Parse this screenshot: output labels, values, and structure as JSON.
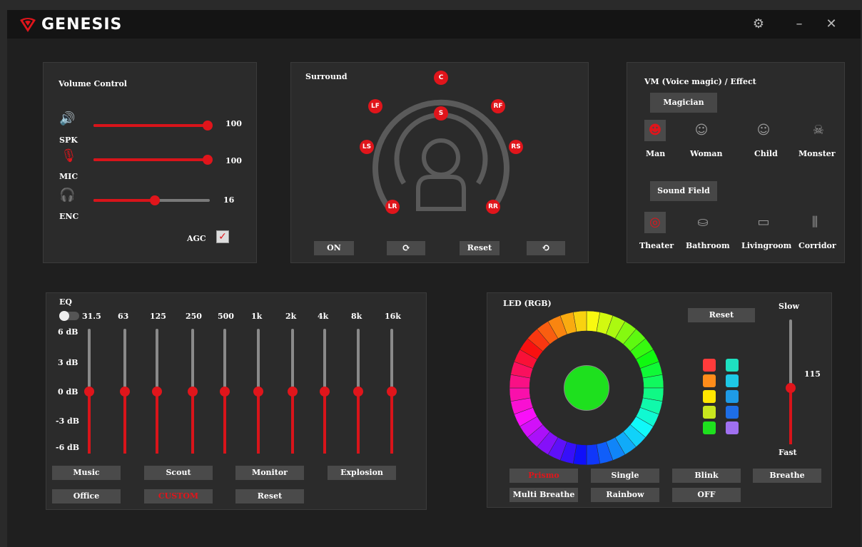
{
  "app": {
    "name": "GENESIS"
  },
  "window": {
    "settings_icon": "gear-icon",
    "minimize": "–",
    "close": "✕"
  },
  "volume": {
    "title": "Volume Control",
    "rows": [
      {
        "label": "SPK",
        "value": "100",
        "level": 1.0,
        "icon": "speaker-icon"
      },
      {
        "label": "MIC",
        "value": "100",
        "level": 1.0,
        "icon": "microphone-icon"
      },
      {
        "label": "ENC",
        "value": "16",
        "level": 0.52,
        "icon": "headphones-icon"
      }
    ],
    "agc_label": "AGC",
    "agc_checked": true
  },
  "surround": {
    "title": "Surround",
    "speakers": [
      "C",
      "LF",
      "RF",
      "S",
      "LS",
      "RS",
      "LR",
      "RR"
    ],
    "buttons": {
      "on": "ON",
      "rotate_cw": "⟳",
      "reset": "Reset",
      "rotate_ccw": "⟲"
    }
  },
  "vm": {
    "title": "VM (Voice magic) / Effect",
    "magician_label": "Magician",
    "voices": [
      {
        "label": "Man",
        "icon": "man-icon",
        "selected": true
      },
      {
        "label": "Woman",
        "icon": "woman-icon",
        "selected": false
      },
      {
        "label": "Child",
        "icon": "child-icon",
        "selected": false
      },
      {
        "label": "Monster",
        "icon": "monster-icon",
        "selected": false
      }
    ],
    "soundfield_label": "Sound Field",
    "fields": [
      {
        "label": "Theater",
        "icon": "theater-icon",
        "selected": true
      },
      {
        "label": "Bathroom",
        "icon": "bathtub-icon",
        "selected": false
      },
      {
        "label": "Livingroom",
        "icon": "sofa-icon",
        "selected": false
      },
      {
        "label": "Corridor",
        "icon": "corridor-icon",
        "selected": false
      }
    ]
  },
  "eq": {
    "title": "EQ",
    "bands": [
      "31.5",
      "63",
      "125",
      "250",
      "500",
      "1k",
      "2k",
      "4k",
      "8k",
      "16k"
    ],
    "band_levels_db": [
      0,
      0,
      0,
      0,
      0,
      0,
      0,
      0,
      0,
      0
    ],
    "db_labels": [
      "6 dB",
      "3 dB",
      "0 dB",
      "-3 dB",
      "-6 dB"
    ],
    "presets_row1": [
      "Music",
      "Scout",
      "Monitor",
      "Explosion"
    ],
    "presets_row2": [
      "Office",
      "CUSTOM",
      "Reset"
    ],
    "active_preset": "CUSTOM"
  },
  "led": {
    "title": "LED (RGB)",
    "reset": "Reset",
    "current_color": "#1ee01e",
    "speed_top": "Slow",
    "speed_bottom": "Fast",
    "speed_value": "115",
    "speed_level": 0.55,
    "swatches_left": [
      "#ff3b3b",
      "#ff8c1a",
      "#ffe600",
      "#c8e61e",
      "#1ee01e"
    ],
    "swatches_right": [
      "#1ee0c0",
      "#1ec8e6",
      "#1e9be6",
      "#1e6ee6",
      "#a070f0"
    ],
    "modes_row1": [
      "Prismo",
      "Single",
      "Blink",
      "Breathe"
    ],
    "modes_row2": [
      "Multi Breathe",
      "Rainbow",
      "OFF"
    ],
    "active_mode": "Prismo"
  }
}
